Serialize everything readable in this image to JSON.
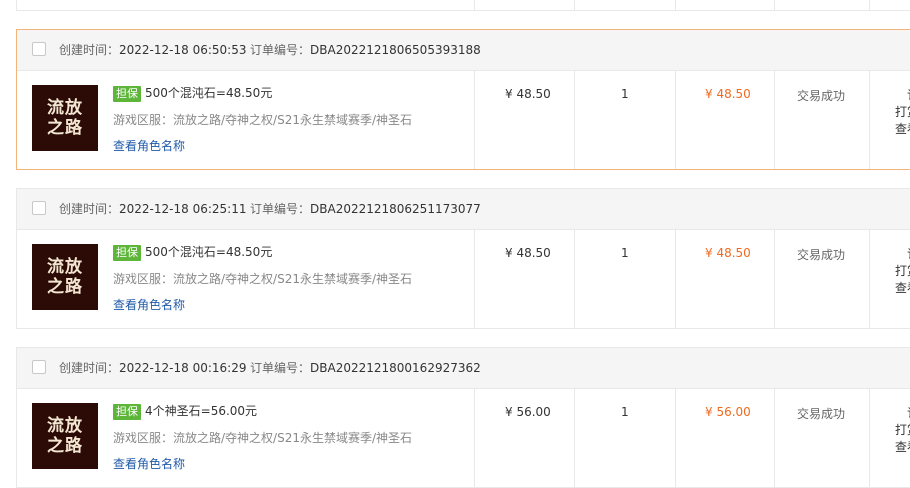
{
  "labels": {
    "created": "创建时间：",
    "order_no": "订单编号：",
    "server": "游戏区服：",
    "view_character": "查看角色名称"
  },
  "colors": {
    "accent": "#f06a1e",
    "badge": "#5db53a",
    "link": "#1f5aa8",
    "active_border": "#f3b47a"
  },
  "orders": [
    {
      "created": "2022-12-18 06:50:53",
      "order_no": "DBA2022121806505393188",
      "badge": "担保",
      "title": "500个混沌石=48.50元",
      "server": "流放之路/夺神之权/S21永生禁域赛季/神圣石",
      "game_logo_line1": "流放",
      "game_logo_line2": "之路",
      "price": "¥ 48.50",
      "qty": "1",
      "total": "¥ 48.50",
      "status": "交易成功",
      "action_1": "订",
      "action_2": "打赏",
      "action_3": "查看"
    },
    {
      "created": "2022-12-18 06:25:11",
      "order_no": "DBA2022121806251173077",
      "badge": "担保",
      "title": "500个混沌石=48.50元",
      "server": "流放之路/夺神之权/S21永生禁域赛季/神圣石",
      "game_logo_line1": "流放",
      "game_logo_line2": "之路",
      "price": "¥ 48.50",
      "qty": "1",
      "total": "¥ 48.50",
      "status": "交易成功",
      "action_1": "订",
      "action_2": "打赏",
      "action_3": "查看"
    },
    {
      "created": "2022-12-18 00:16:29",
      "order_no": "DBA2022121800162927362",
      "badge": "担保",
      "title": "4个神圣石=56.00元",
      "server": "流放之路/夺神之权/S21永生禁域赛季/神圣石",
      "game_logo_line1": "流放",
      "game_logo_line2": "之路",
      "price": "¥ 56.00",
      "qty": "1",
      "total": "¥ 56.00",
      "status": "交易成功",
      "action_1": "订",
      "action_2": "打赏",
      "action_3": "查看"
    }
  ]
}
